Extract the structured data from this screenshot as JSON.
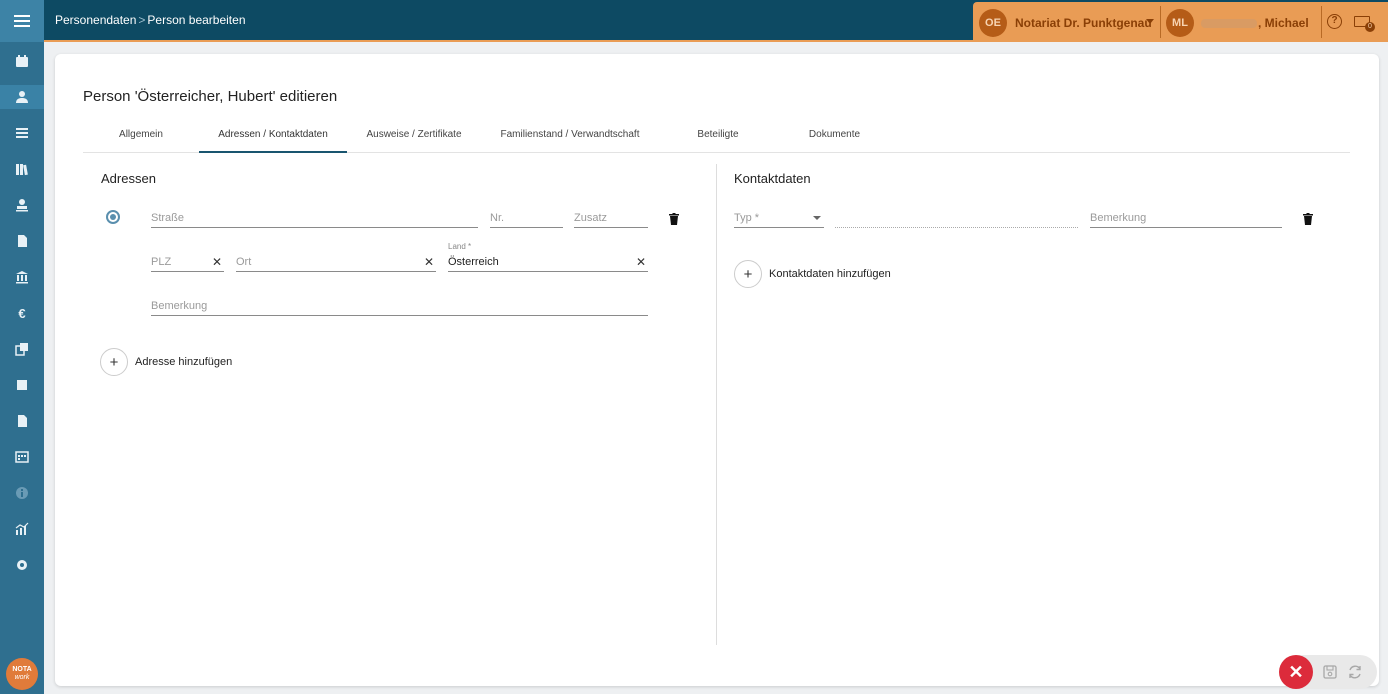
{
  "breadcrumb": {
    "part1": "Personendaten",
    "separator": ">",
    "part2": "Person bearbeiten"
  },
  "header": {
    "office_initials": "OE",
    "office_name": "Notariat Dr. Punktgenau",
    "user_initials": "ML",
    "user_name_suffix": ", Michael",
    "mail_badge": "0"
  },
  "page": {
    "title": "Person 'Österreicher, Hubert' editieren"
  },
  "tabs": [
    {
      "label": "Allgemein"
    },
    {
      "label": "Adressen / Kontaktdaten"
    },
    {
      "label": "Ausweise / Zertifikate"
    },
    {
      "label": "Familienstand / Verwandtschaft"
    },
    {
      "label": "Beteiligte"
    },
    {
      "label": "Dokumente"
    }
  ],
  "addresses": {
    "title": "Adressen",
    "street_placeholder": "Straße",
    "number_placeholder": "Nr.",
    "suffix_placeholder": "Zusatz",
    "zip_placeholder": "PLZ",
    "city_placeholder": "Ort",
    "country_label": "Land *",
    "country_value": "Österreich",
    "remark_placeholder": "Bemerkung",
    "add_label": "Adresse hinzufügen"
  },
  "contacts": {
    "title": "Kontaktdaten",
    "type_placeholder": "Typ *",
    "remark_placeholder": "Bemerkung",
    "add_label": "Kontaktdaten hinzufügen"
  },
  "logo": {
    "line1": "NOTA",
    "line2": "work"
  },
  "colors": {
    "sidebar": "#2f6f8f",
    "topbar": "#0d4a63",
    "accent": "#e99c55",
    "close": "#dc2b3b"
  }
}
